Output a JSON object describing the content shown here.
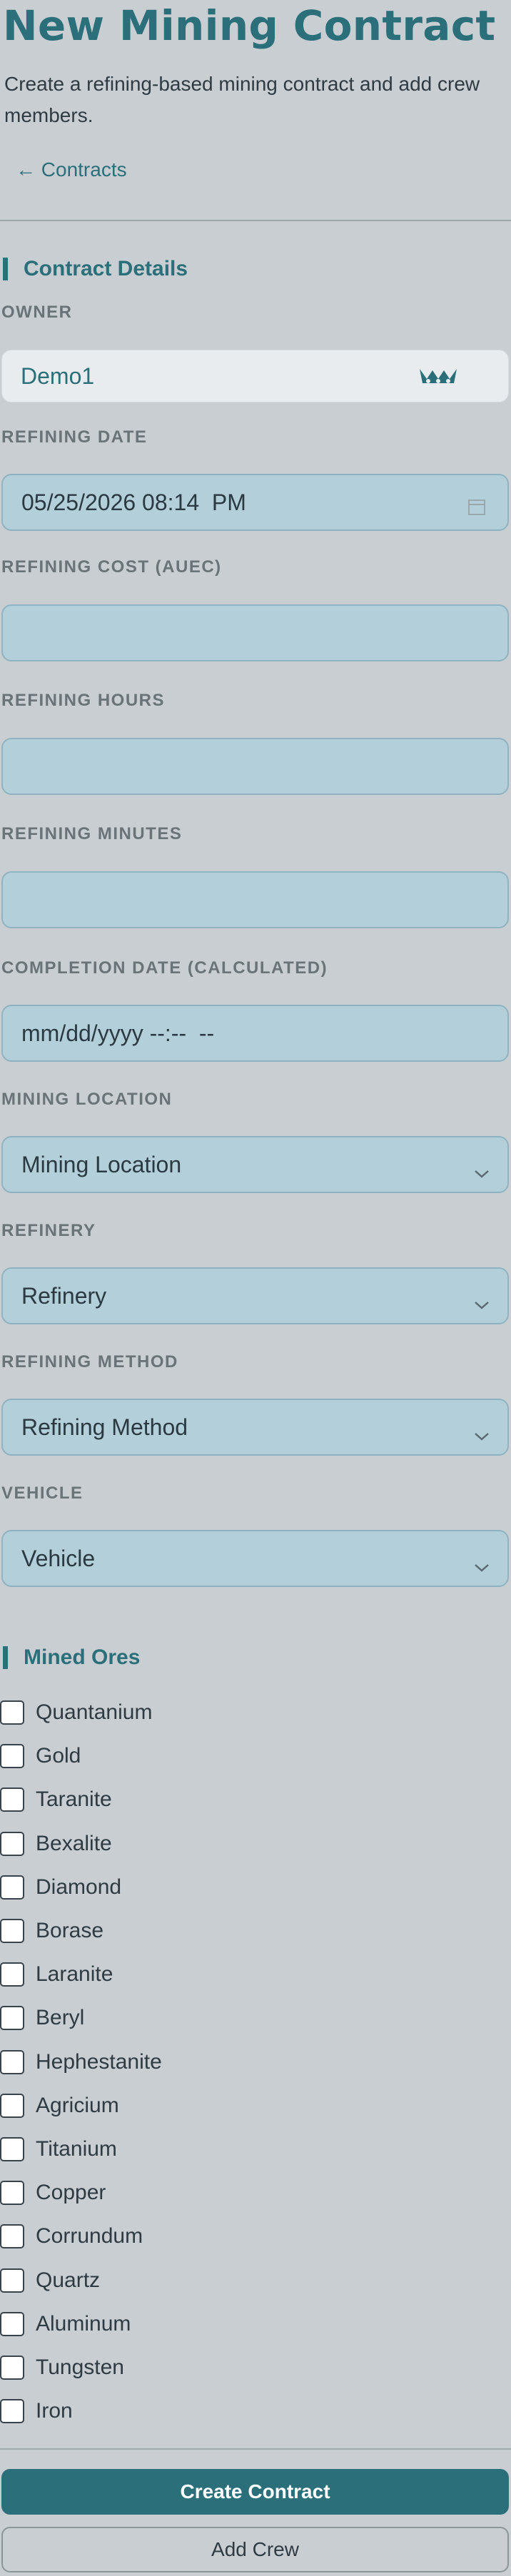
{
  "header": {
    "title": "New Mining Contract",
    "subtitle": "Create a refining-based mining contract and add crew members.",
    "back_link": "← Contracts"
  },
  "contract_details": {
    "heading": "Contract Details",
    "owner": {
      "label": "OWNER",
      "value": "Demo1",
      "icon": "crown-icon"
    },
    "refining_date": {
      "label": "REFINING DATE",
      "value": "05/25/2026 08:14  PM",
      "icon": "calendar-icon"
    },
    "refining_cost": {
      "label": "REFINING COST (AUEC)",
      "value": ""
    },
    "refining_hours": {
      "label": "REFINING HOURS",
      "value": ""
    },
    "refining_minutes": {
      "label": "REFINING MINUTES",
      "value": ""
    },
    "completion_date": {
      "label": "COMPLETION DATE (CALCULATED)",
      "placeholder": "mm/dd/yyyy --:--  --"
    },
    "mining_location": {
      "label": "MINING LOCATION",
      "selected": "Mining Location"
    },
    "refinery": {
      "label": "REFINERY",
      "selected": "Refinery"
    },
    "refining_method": {
      "label": "REFINING METHOD",
      "selected": "Refining Method"
    },
    "vehicle": {
      "label": "VEHICLE",
      "selected": "Vehicle"
    }
  },
  "mined_ores": {
    "heading": "Mined Ores",
    "items": [
      "Quantanium",
      "Gold",
      "Taranite",
      "Bexalite",
      "Diamond",
      "Borase",
      "Laranite",
      "Beryl",
      "Hephestanite",
      "Agricium",
      "Titanium",
      "Copper",
      "Corrundum",
      "Quartz",
      "Aluminum",
      "Tungsten",
      "Iron"
    ]
  },
  "actions": {
    "create_label": "Create Contract",
    "add_crew_label": "Add Crew"
  },
  "colors": {
    "accent": "#2b6f7a",
    "background": "#c9ced2",
    "field_bg": "#b3cfd9"
  }
}
